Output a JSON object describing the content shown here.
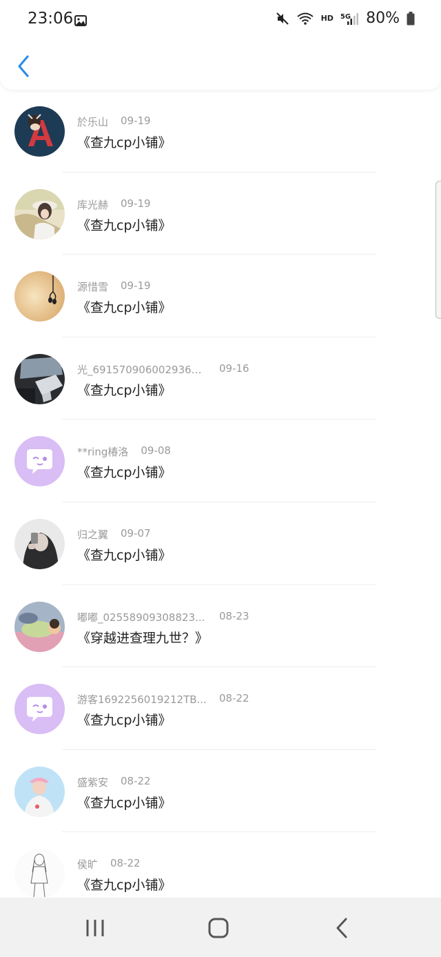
{
  "status_bar": {
    "time": "23:06",
    "battery": "80%",
    "network_hd": "HD",
    "network_5g": "5G",
    "icons": [
      "image-icon",
      "mute-icon",
      "wifi-icon",
      "signal-icon",
      "battery-icon"
    ]
  },
  "header": {
    "back_icon": "chevron-left-icon",
    "accent_color": "#2b8fe8"
  },
  "items": [
    {
      "name": "於乐山",
      "date": "09-19",
      "title": "《查九cp小铺》",
      "avatar": "a-letter"
    },
    {
      "name": "库光赫",
      "date": "09-19",
      "title": "《查九cp小铺》",
      "avatar": "girl-hat"
    },
    {
      "name": "源惜雪",
      "date": "09-19",
      "title": "《查九cp小铺》",
      "avatar": "earphones"
    },
    {
      "name": "光_6915709060029363...",
      "date": "09-16",
      "title": "《查九cp小铺》",
      "avatar": "car"
    },
    {
      "name": "**ring椿洛",
      "date": "09-08",
      "title": "《查九cp小铺》",
      "avatar": "default-chat"
    },
    {
      "name": "归之翼",
      "date": "09-07",
      "title": "《查九cp小铺》",
      "avatar": "hoodie"
    },
    {
      "name": "嘟嘟_02558909308823...",
      "date": "08-23",
      "title": "《穿越进查理九世？》",
      "avatar": "baby"
    },
    {
      "name": "游客1692256019212TB...",
      "date": "08-22",
      "title": "《查九cp小铺》",
      "avatar": "default-chat"
    },
    {
      "name": "盛紫安",
      "date": "08-22",
      "title": "《查九cp小铺》",
      "avatar": "cartoon-boy"
    },
    {
      "name": "侯旷",
      "date": "08-22",
      "title": "《查九cp小铺》",
      "avatar": "sketch"
    }
  ],
  "nav": {
    "recents_icon": "recents-icon",
    "home_icon": "home-icon",
    "back_icon": "back-icon"
  }
}
